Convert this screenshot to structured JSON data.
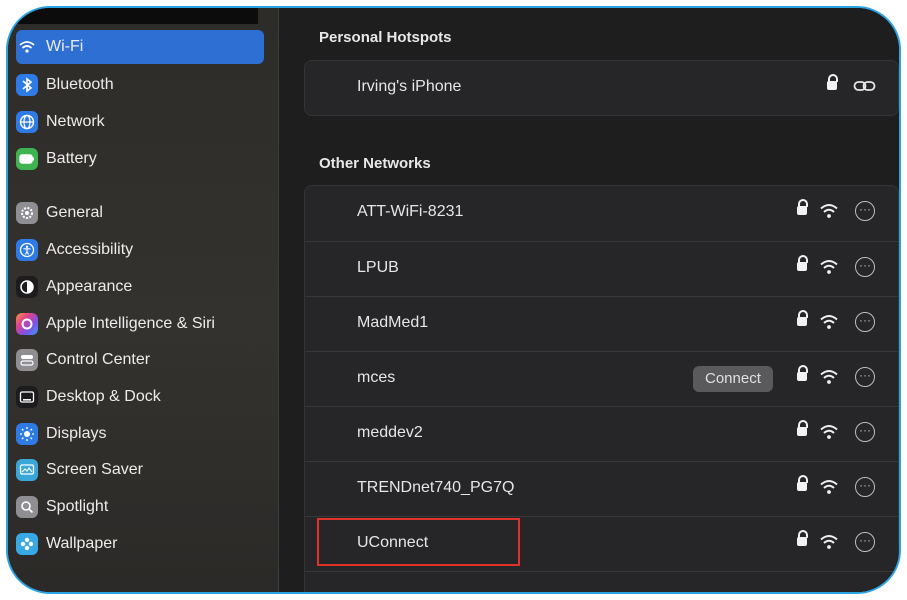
{
  "sidebar": {
    "items": [
      {
        "label": "Wi-Fi",
        "icon": "wifi-icon",
        "color": "#2d6fd3",
        "selected": true
      },
      {
        "label": "Bluetooth",
        "icon": "bluetooth-icon",
        "color": "#2f7be5"
      },
      {
        "label": "Network",
        "icon": "globe-icon",
        "color": "#2f7be5"
      },
      {
        "label": "Battery",
        "icon": "battery-icon",
        "color": "#3fb34f"
      },
      {
        "label": "General",
        "icon": "gear-icon",
        "color": "#8e8e93"
      },
      {
        "label": "Accessibility",
        "icon": "accessibility-icon",
        "color": "#2f7be5"
      },
      {
        "label": "Appearance",
        "icon": "appearance-icon",
        "color": "#1c1c1e"
      },
      {
        "label": "Apple Intelligence & Siri",
        "icon": "siri-icon",
        "color": "#c04ad8"
      },
      {
        "label": "Control Center",
        "icon": "control-center-icon",
        "color": "#8e8e93"
      },
      {
        "label": "Desktop & Dock",
        "icon": "desktop-dock-icon",
        "color": "#1c1c1e"
      },
      {
        "label": "Displays",
        "icon": "sun-icon",
        "color": "#2f7be5"
      },
      {
        "label": "Screen Saver",
        "icon": "screen-saver-icon",
        "color": "#3aa7d8"
      },
      {
        "label": "Spotlight",
        "icon": "magnifier-icon",
        "color": "#8e8e93"
      },
      {
        "label": "Wallpaper",
        "icon": "flower-icon",
        "color": "#38a8e6"
      }
    ]
  },
  "hotspots": {
    "title": "Personal Hotspots",
    "items": [
      {
        "name": "Irving's iPhone"
      }
    ]
  },
  "other": {
    "title": "Other Networks",
    "connect_label": "Connect",
    "items": [
      {
        "name": "ATT-WiFi-8231"
      },
      {
        "name": "LPUB"
      },
      {
        "name": "MadMed1"
      },
      {
        "name": "mces"
      },
      {
        "name": "meddev2"
      },
      {
        "name": "TRENDnet740_PG7Q"
      },
      {
        "name": "UConnect"
      }
    ]
  },
  "colors": {
    "accent": "#2d6fd3",
    "highlight": "#e0312b",
    "frame": "#2aa3e0"
  }
}
